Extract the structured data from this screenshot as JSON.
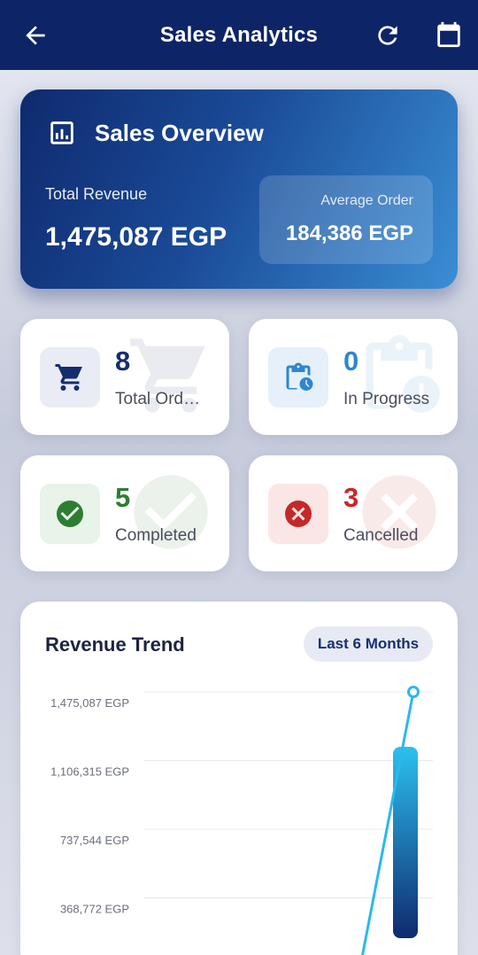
{
  "appbar": {
    "title": "Sales Analytics",
    "back_icon": "arrow-left-icon",
    "refresh_icon": "refresh-icon",
    "calendar_icon": "calendar-icon"
  },
  "overview": {
    "title": "Sales Overview",
    "icon": "bar-chart-icon",
    "total_revenue_label": "Total Revenue",
    "total_revenue_value": "1,475,087 EGP",
    "average_order_label": "Average Order",
    "average_order_value": "184,386 EGP"
  },
  "stats": [
    {
      "value": "8",
      "label": "Total Ord…",
      "icon": "shopping-cart-icon",
      "color": "#152d6e",
      "bg": "#e9ecf5"
    },
    {
      "value": "0",
      "label": "In Progress",
      "icon": "clipboard-clock-icon",
      "color": "#2f86d0",
      "bg": "#e5f0fb"
    },
    {
      "value": "5",
      "label": "Completed",
      "icon": "check-circle-icon",
      "color": "#2e7d32",
      "bg": "#e8f3ea"
    },
    {
      "value": "3",
      "label": "Cancelled",
      "icon": "cancel-circle-icon",
      "color": "#c62828",
      "bg": "#fbe6e6"
    }
  ],
  "chart": {
    "title": "Revenue Trend",
    "range_button": "Last 6 Months"
  },
  "chart_data": {
    "type": "bar",
    "title": "Revenue Trend",
    "y_tick_labels": [
      "1,475,087 EGP",
      "1,106,315 EGP",
      "737,544 EGP",
      "368,772 EGP"
    ],
    "ylim": [
      0,
      1475087
    ],
    "series": [
      {
        "type": "bar",
        "values": [
          0,
          0,
          0,
          0,
          0,
          1180000
        ]
      },
      {
        "type": "line",
        "values": [
          0,
          0,
          0,
          0,
          0,
          1475087
        ]
      }
    ],
    "grid": true,
    "colors": {
      "bar_top": "#2cc0f0",
      "bar_bottom": "#0f2a6e",
      "line": "#2cb8ee"
    }
  }
}
